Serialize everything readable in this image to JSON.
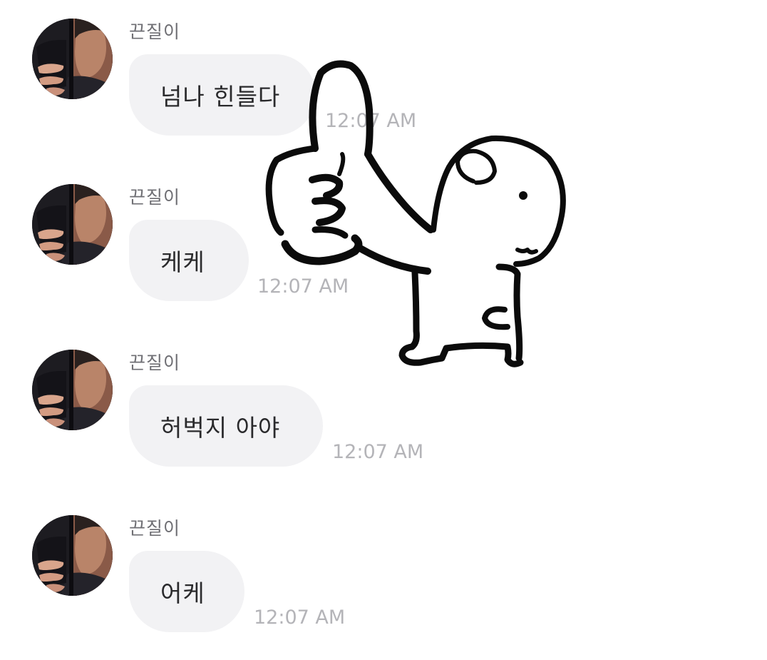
{
  "messages": [
    {
      "sender": "끈질이",
      "text": "넘나 힌들다",
      "time": "12:07 AM"
    },
    {
      "sender": "끈질이",
      "text": "케케",
      "time": "12:07 AM"
    },
    {
      "sender": "끈질이",
      "text": "허벅지 아야",
      "time": "12:07 AM"
    },
    {
      "sender": "끈질이",
      "text": "어케",
      "time": "12:07 AM"
    }
  ],
  "sticker": {
    "icon": "thumbs-up-character-sticker"
  },
  "colors": {
    "bubble": "#f2f2f4",
    "message_text": "#2a2a2c",
    "sender_text": "#6e6e73",
    "time_text": "#b4b4b8"
  }
}
